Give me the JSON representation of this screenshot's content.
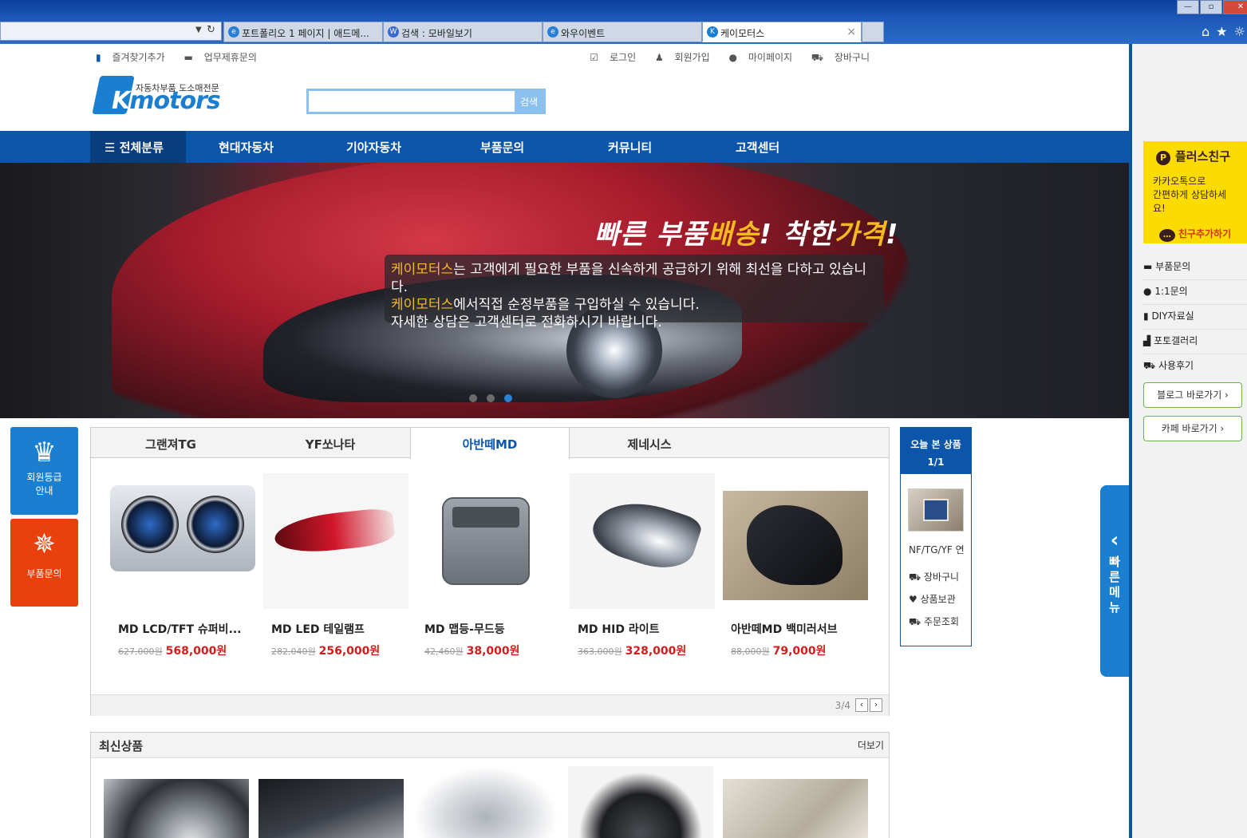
{
  "browser": {
    "tabs": [
      {
        "label": "포트폴리오 1 페이지 | 애드메..."
      },
      {
        "label": "검색 : 모바일보기"
      },
      {
        "label": "와우이벤트"
      },
      {
        "label": "케이모터스"
      }
    ],
    "win_min": "—",
    "win_max": "▫",
    "win_close": "✕",
    "toolbar_icons": "⌂★☼"
  },
  "topbar": {
    "bookmark": "즐겨찾기추가",
    "partnership": "업무제휴문의",
    "login": "로그인",
    "join": "회원가입",
    "mypage": "마이페이지",
    "cart": "장바구니"
  },
  "logo": {
    "sub": "자동차부품 도소매전문",
    "k": "K",
    "name": "motors"
  },
  "search": {
    "button": "검색",
    "placeholder": ""
  },
  "nav": {
    "all": "☰ 전체분류",
    "items": [
      "현대자동차",
      "기아자동차",
      "부품문의",
      "커뮤니티",
      "고객센터"
    ]
  },
  "hero": {
    "headline_a": "빠른 부품",
    "headline_b": "배송",
    "headline_c": "! 착한",
    "headline_d": "가격",
    "headline_e": "!",
    "line1_brand": "케이모터스",
    "line1_rest": "는 고객에게 필요한 부품을 신속하게 공급하기 위해 최선을 다하고 있습니다.",
    "line2_brand": "케이모터스",
    "line2_rest": "에서직접 순정부품을 구입하실 수 있습니다.",
    "line3": "자세한 상담은 고객센터로 전화하시기 바랍니다."
  },
  "left_float": {
    "grade": "회원등급\n안내",
    "inquiry": "부품문의"
  },
  "product_tabs": [
    "그랜져TG",
    "YF쏘나타",
    "아반떼MD",
    "제네시스"
  ],
  "products": [
    {
      "name": "MD LCD/TFT 슈퍼비...",
      "old": "627,000원",
      "price": "568,000원"
    },
    {
      "name": "MD LED 테일램프",
      "old": "282,040원",
      "price": "256,000원"
    },
    {
      "name": "MD 맵등-무드등",
      "old": "42,460원",
      "price": "38,000원"
    },
    {
      "name": "MD HID 라이트",
      "old": "363,000원",
      "price": "328,000원"
    },
    {
      "name": "아반떼MD 백미러서브",
      "old": "88,000원",
      "price": "79,000원"
    }
  ],
  "product_pager": {
    "current": "3",
    "total": "/4",
    "prev": "‹",
    "next": "›"
  },
  "recent": {
    "title": "오늘 본 상품",
    "count": "1/1",
    "item_name": "NF/TG/YF 연",
    "cart": "장바구니",
    "wish": "상품보관",
    "order": "주문조회"
  },
  "newest": {
    "title": "최신상품",
    "more": "더보기"
  },
  "quick_tab": {
    "arrow": "‹",
    "label": "빠\n른\n메\n뉴"
  },
  "side": {
    "kakao_title": "플러스친구",
    "kakao_desc": "카카오톡으로\n간편하게 상담하세요!",
    "kakao_btn": "친구추가하기",
    "links": [
      "부품문의",
      "1:1문의",
      "DIY자료실",
      "포토갤러리",
      "사용후기"
    ],
    "blog": "블로그 바로가기 ›",
    "cafe": "카페 바로가기 ›"
  }
}
